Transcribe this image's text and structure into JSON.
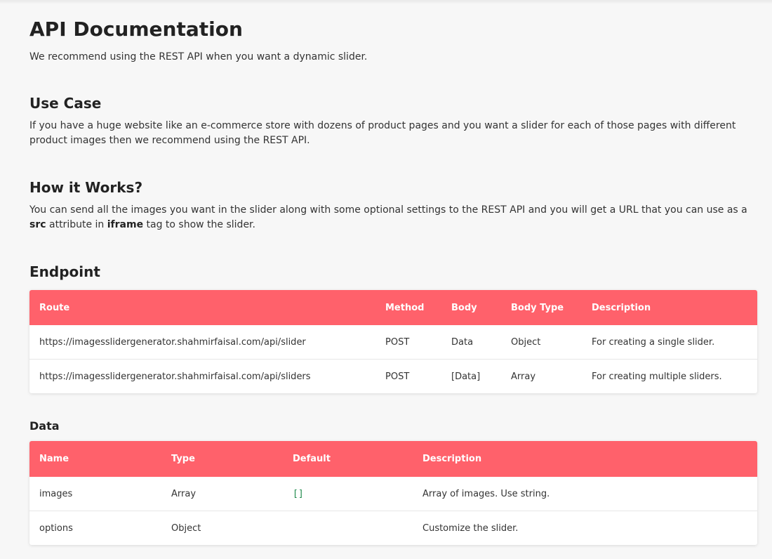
{
  "title": "API Documentation",
  "intro": "We recommend using the REST API when you want a dynamic slider.",
  "use_case": {
    "heading": "Use Case",
    "text": "If you have a huge website like an e-commerce store with dozens of product pages and you want a slider for each of those pages with different product images then we recommend using the REST API."
  },
  "how_it_works": {
    "heading": "How it Works?",
    "text_before": "You can send all the images you want in the slider along with some optional settings to the REST API and you will get a URL that you can use as a",
    "strong_src": "src",
    "text_middle": "attribute in",
    "strong_iframe": "iframe",
    "text_after": "tag to show the slider."
  },
  "endpoint": {
    "heading": "Endpoint",
    "headers": [
      "Route",
      "Method",
      "Body",
      "Body Type",
      "Description"
    ],
    "rows": [
      [
        "https://imagesslidergenerator.shahmirfaisal.com/api/slider",
        "POST",
        "Data",
        "Object",
        "For creating a single slider."
      ],
      [
        "https://imagesslidergenerator.shahmirfaisal.com/api/sliders",
        "POST",
        "[Data]",
        "Array",
        "For creating multiple sliders."
      ]
    ]
  },
  "data_section": {
    "heading": "Data",
    "headers": [
      "Name",
      "Type",
      "Default",
      "Description"
    ],
    "rows": [
      [
        "images",
        "Array",
        "[]",
        "Array of images. Use string."
      ],
      [
        "options",
        "Object",
        "",
        "Customize the slider."
      ]
    ]
  },
  "colors": {
    "table_header": "#ff616b",
    "background": "#f7f7f7",
    "default_value": "#1f8a4c"
  }
}
